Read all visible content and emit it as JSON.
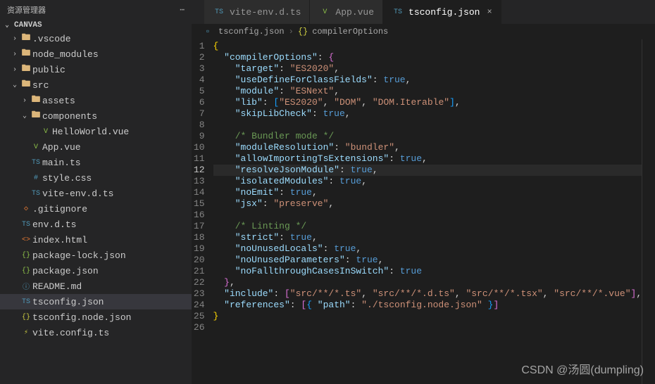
{
  "sidebar": {
    "title": "资源管理器",
    "root": "CANVAS",
    "items": [
      {
        "depth": 0,
        "type": "folder",
        "open": false,
        "icon": "folder",
        "color": "fc-folder",
        "label": ".vscode"
      },
      {
        "depth": 0,
        "type": "folder",
        "open": false,
        "icon": "folder",
        "color": "fc-folder",
        "label": "node_modules"
      },
      {
        "depth": 0,
        "type": "folder",
        "open": false,
        "icon": "folder",
        "color": "fc-folder",
        "label": "public"
      },
      {
        "depth": 0,
        "type": "folder",
        "open": true,
        "icon": "folder",
        "color": "fc-folder",
        "label": "src"
      },
      {
        "depth": 1,
        "type": "folder",
        "open": false,
        "icon": "folder",
        "color": "fc-folder",
        "label": "assets"
      },
      {
        "depth": 1,
        "type": "folder",
        "open": true,
        "icon": "folder",
        "color": "fc-folder",
        "label": "components"
      },
      {
        "depth": 2,
        "type": "file",
        "icon": "V",
        "color": "fc-green",
        "label": "HelloWorld.vue"
      },
      {
        "depth": 1,
        "type": "file",
        "icon": "V",
        "color": "fc-green",
        "label": "App.vue"
      },
      {
        "depth": 1,
        "type": "file",
        "icon": "TS",
        "color": "fc-blue",
        "label": "main.ts"
      },
      {
        "depth": 1,
        "type": "file",
        "icon": "#",
        "color": "fc-blue",
        "label": "style.css"
      },
      {
        "depth": 1,
        "type": "file",
        "icon": "TS",
        "color": "fc-blue",
        "label": "vite-env.d.ts"
      },
      {
        "depth": 0,
        "type": "file",
        "icon": "◇",
        "color": "fc-orange",
        "label": ".gitignore"
      },
      {
        "depth": 0,
        "type": "file",
        "icon": "TS",
        "color": "fc-blue",
        "label": "env.d.ts"
      },
      {
        "depth": 0,
        "type": "file",
        "icon": "<>",
        "color": "fc-orange",
        "label": "index.html"
      },
      {
        "depth": 0,
        "type": "file",
        "icon": "{}",
        "color": "fc-green",
        "label": "package-lock.json"
      },
      {
        "depth": 0,
        "type": "file",
        "icon": "{}",
        "color": "fc-green",
        "label": "package.json"
      },
      {
        "depth": 0,
        "type": "file",
        "icon": "ⓘ",
        "color": "fc-blue",
        "label": "README.md"
      },
      {
        "depth": 0,
        "type": "file",
        "icon": "TS",
        "color": "fc-blue",
        "label": "tsconfig.json",
        "selected": true
      },
      {
        "depth": 0,
        "type": "file",
        "icon": "{}",
        "color": "fc-yellow",
        "label": "tsconfig.node.json"
      },
      {
        "depth": 0,
        "type": "file",
        "icon": "⚡",
        "color": "fc-yellow",
        "label": "vite.config.ts"
      }
    ]
  },
  "tabs": [
    {
      "icon": "TS",
      "color": "fc-blue",
      "label": "vite-env.d.ts",
      "active": false
    },
    {
      "icon": "V",
      "color": "fc-green",
      "label": "App.vue",
      "active": false
    },
    {
      "icon": "TS",
      "color": "fc-blue",
      "label": "tsconfig.json",
      "active": true
    }
  ],
  "breadcrumb": {
    "file": "tsconfig.json",
    "symbol": "compilerOptions",
    "symbolIcon": "{}"
  },
  "code": {
    "currentLine": 12,
    "lines": [
      [
        {
          "t": "{",
          "c": "br1"
        }
      ],
      [
        {
          "t": "  ",
          "c": "p"
        },
        {
          "t": "\"compilerOptions\"",
          "c": "k"
        },
        {
          "t": ": ",
          "c": "p"
        },
        {
          "t": "{",
          "c": "br2"
        }
      ],
      [
        {
          "t": "    ",
          "c": "p"
        },
        {
          "t": "\"target\"",
          "c": "k"
        },
        {
          "t": ": ",
          "c": "p"
        },
        {
          "t": "\"ES2020\"",
          "c": "s"
        },
        {
          "t": ",",
          "c": "p"
        }
      ],
      [
        {
          "t": "    ",
          "c": "p"
        },
        {
          "t": "\"useDefineForClassFields\"",
          "c": "k"
        },
        {
          "t": ": ",
          "c": "p"
        },
        {
          "t": "true",
          "c": "b"
        },
        {
          "t": ",",
          "c": "p"
        }
      ],
      [
        {
          "t": "    ",
          "c": "p"
        },
        {
          "t": "\"module\"",
          "c": "k"
        },
        {
          "t": ": ",
          "c": "p"
        },
        {
          "t": "\"ESNext\"",
          "c": "s"
        },
        {
          "t": ",",
          "c": "p"
        }
      ],
      [
        {
          "t": "    ",
          "c": "p"
        },
        {
          "t": "\"lib\"",
          "c": "k"
        },
        {
          "t": ": ",
          "c": "p"
        },
        {
          "t": "[",
          "c": "br3"
        },
        {
          "t": "\"ES2020\"",
          "c": "s"
        },
        {
          "t": ", ",
          "c": "p"
        },
        {
          "t": "\"DOM\"",
          "c": "s"
        },
        {
          "t": ", ",
          "c": "p"
        },
        {
          "t": "\"DOM.Iterable\"",
          "c": "s"
        },
        {
          "t": "]",
          "c": "br3"
        },
        {
          "t": ",",
          "c": "p"
        }
      ],
      [
        {
          "t": "    ",
          "c": "p"
        },
        {
          "t": "\"skipLibCheck\"",
          "c": "k"
        },
        {
          "t": ": ",
          "c": "p"
        },
        {
          "t": "true",
          "c": "b"
        },
        {
          "t": ",",
          "c": "p"
        }
      ],
      [],
      [
        {
          "t": "    ",
          "c": "p"
        },
        {
          "t": "/* Bundler mode */",
          "c": "c"
        }
      ],
      [
        {
          "t": "    ",
          "c": "p"
        },
        {
          "t": "\"moduleResolution\"",
          "c": "k"
        },
        {
          "t": ": ",
          "c": "p"
        },
        {
          "t": "\"bundler\"",
          "c": "s"
        },
        {
          "t": ",",
          "c": "p"
        }
      ],
      [
        {
          "t": "    ",
          "c": "p"
        },
        {
          "t": "\"allowImportingTsExtensions\"",
          "c": "k"
        },
        {
          "t": ": ",
          "c": "p"
        },
        {
          "t": "true",
          "c": "b"
        },
        {
          "t": ",",
          "c": "p"
        }
      ],
      [
        {
          "t": "    ",
          "c": "p"
        },
        {
          "t": "\"resolveJsonModule\"",
          "c": "k"
        },
        {
          "t": ": ",
          "c": "p"
        },
        {
          "t": "true",
          "c": "b"
        },
        {
          "t": ",",
          "c": "p"
        }
      ],
      [
        {
          "t": "    ",
          "c": "p"
        },
        {
          "t": "\"isolatedModules\"",
          "c": "k"
        },
        {
          "t": ": ",
          "c": "p"
        },
        {
          "t": "true",
          "c": "b"
        },
        {
          "t": ",",
          "c": "p"
        }
      ],
      [
        {
          "t": "    ",
          "c": "p"
        },
        {
          "t": "\"noEmit\"",
          "c": "k"
        },
        {
          "t": ": ",
          "c": "p"
        },
        {
          "t": "true",
          "c": "b"
        },
        {
          "t": ",",
          "c": "p"
        }
      ],
      [
        {
          "t": "    ",
          "c": "p"
        },
        {
          "t": "\"jsx\"",
          "c": "k"
        },
        {
          "t": ": ",
          "c": "p"
        },
        {
          "t": "\"preserve\"",
          "c": "s"
        },
        {
          "t": ",",
          "c": "p"
        }
      ],
      [],
      [
        {
          "t": "    ",
          "c": "p"
        },
        {
          "t": "/* Linting */",
          "c": "c"
        }
      ],
      [
        {
          "t": "    ",
          "c": "p"
        },
        {
          "t": "\"strict\"",
          "c": "k"
        },
        {
          "t": ": ",
          "c": "p"
        },
        {
          "t": "true",
          "c": "b"
        },
        {
          "t": ",",
          "c": "p"
        }
      ],
      [
        {
          "t": "    ",
          "c": "p"
        },
        {
          "t": "\"noUnusedLocals\"",
          "c": "k"
        },
        {
          "t": ": ",
          "c": "p"
        },
        {
          "t": "true",
          "c": "b"
        },
        {
          "t": ",",
          "c": "p"
        }
      ],
      [
        {
          "t": "    ",
          "c": "p"
        },
        {
          "t": "\"noUnusedParameters\"",
          "c": "k"
        },
        {
          "t": ": ",
          "c": "p"
        },
        {
          "t": "true",
          "c": "b"
        },
        {
          "t": ",",
          "c": "p"
        }
      ],
      [
        {
          "t": "    ",
          "c": "p"
        },
        {
          "t": "\"noFallthroughCasesInSwitch\"",
          "c": "k"
        },
        {
          "t": ": ",
          "c": "p"
        },
        {
          "t": "true",
          "c": "b"
        }
      ],
      [
        {
          "t": "  ",
          "c": "p"
        },
        {
          "t": "}",
          "c": "br2"
        },
        {
          "t": ",",
          "c": "p"
        }
      ],
      [
        {
          "t": "  ",
          "c": "p"
        },
        {
          "t": "\"include\"",
          "c": "k"
        },
        {
          "t": ": ",
          "c": "p"
        },
        {
          "t": "[",
          "c": "br2"
        },
        {
          "t": "\"src/**/*.ts\"",
          "c": "s"
        },
        {
          "t": ", ",
          "c": "p"
        },
        {
          "t": "\"src/**/*.d.ts\"",
          "c": "s"
        },
        {
          "t": ", ",
          "c": "p"
        },
        {
          "t": "\"src/**/*.tsx\"",
          "c": "s"
        },
        {
          "t": ", ",
          "c": "p"
        },
        {
          "t": "\"src/**/*.vue\"",
          "c": "s"
        },
        {
          "t": "]",
          "c": "br2"
        },
        {
          "t": ",",
          "c": "p"
        }
      ],
      [
        {
          "t": "  ",
          "c": "p"
        },
        {
          "t": "\"references\"",
          "c": "k"
        },
        {
          "t": ": ",
          "c": "p"
        },
        {
          "t": "[",
          "c": "br2"
        },
        {
          "t": "{ ",
          "c": "br3"
        },
        {
          "t": "\"path\"",
          "c": "k"
        },
        {
          "t": ": ",
          "c": "p"
        },
        {
          "t": "\"./tsconfig.node.json\"",
          "c": "s"
        },
        {
          "t": " }",
          "c": "br3"
        },
        {
          "t": "]",
          "c": "br2"
        }
      ],
      [
        {
          "t": "}",
          "c": "br1"
        }
      ],
      []
    ]
  },
  "watermark": "CSDN @汤圆(dumpling)"
}
